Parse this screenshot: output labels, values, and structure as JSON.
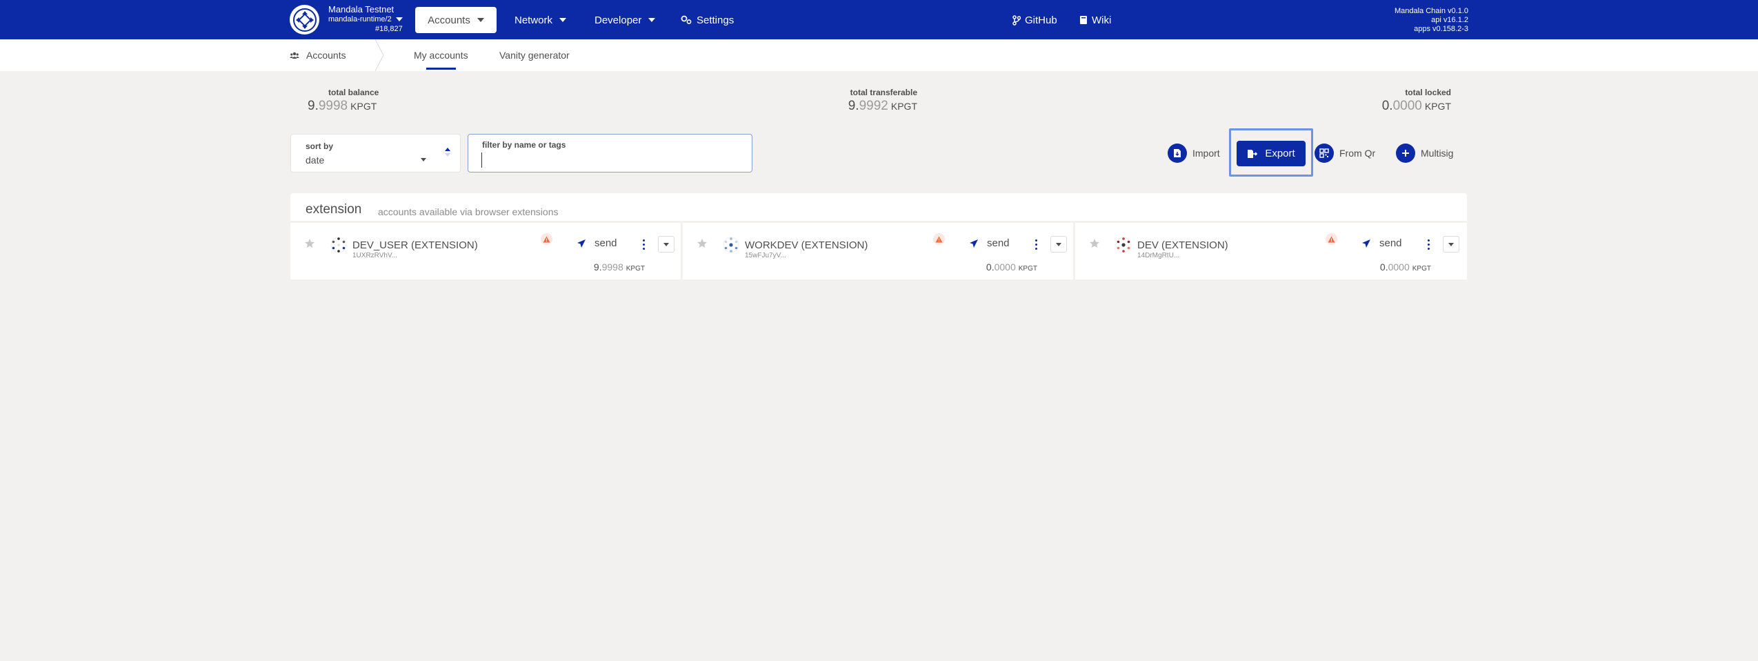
{
  "header": {
    "chain_name": "Mandala Testnet",
    "runtime": "mandala-runtime/2",
    "block": "#18,827",
    "nav": {
      "accounts": "Accounts",
      "network": "Network",
      "developer": "Developer",
      "settings": "Settings",
      "github": "GitHub",
      "wiki": "Wiki"
    },
    "versions": {
      "chain": "Mandala Chain v0.1.0",
      "api": "api v16.1.2",
      "apps": "apps v0.158.2-3"
    }
  },
  "subnav": {
    "section": "Accounts",
    "tabs": [
      "My accounts",
      "Vanity generator"
    ]
  },
  "summary": {
    "total_balance": {
      "label": "total balance",
      "int": "9.",
      "dec": "9998",
      "unit": "KPGT"
    },
    "total_transferable": {
      "label": "total transferable",
      "int": "9.",
      "dec": "9992",
      "unit": "KPGT"
    },
    "total_locked": {
      "label": "total locked",
      "int": "0.",
      "dec": "0000",
      "unit": "KPGT"
    }
  },
  "filters": {
    "sort_label": "sort by",
    "sort_value": "date",
    "filter_label": "filter by name or tags",
    "filter_value": ""
  },
  "actions": {
    "import": "Import",
    "export": "Export",
    "from_qr": "From Qr",
    "multisig": "Multisig"
  },
  "extension": {
    "title": "extension",
    "description": "accounts available via browser extensions",
    "accounts": [
      {
        "name": "DEV_USER (EXTENSION)",
        "address": "1UXRzRVhV...",
        "send": "send",
        "balance_int": "9.",
        "balance_dec": "9998",
        "unit": "KPGT"
      },
      {
        "name": "WORKDEV (EXTENSION)",
        "address": "15wFJu7yV...",
        "send": "send",
        "balance_int": "0.",
        "balance_dec": "0000",
        "unit": "KPGT"
      },
      {
        "name": "DEV (EXTENSION)",
        "address": "14DrMgRtU...",
        "send": "send",
        "balance_int": "0.",
        "balance_dec": "0000",
        "unit": "KPGT"
      }
    ]
  },
  "colors": {
    "brand": "#0c2aa6",
    "background": "#f2f1ef",
    "warning": "#f26b3a",
    "focus_outline": "#6d93e8"
  },
  "icons": [
    "chain-logo-icon",
    "caret-down-icon",
    "settings-icon",
    "github-branch-icon",
    "book-icon",
    "users-icon",
    "import-icon",
    "export-icon",
    "qr-icon",
    "plus-icon",
    "star-icon",
    "warning-icon",
    "paper-plane-icon",
    "more-vertical-icon",
    "chevron-down-icon"
  ]
}
